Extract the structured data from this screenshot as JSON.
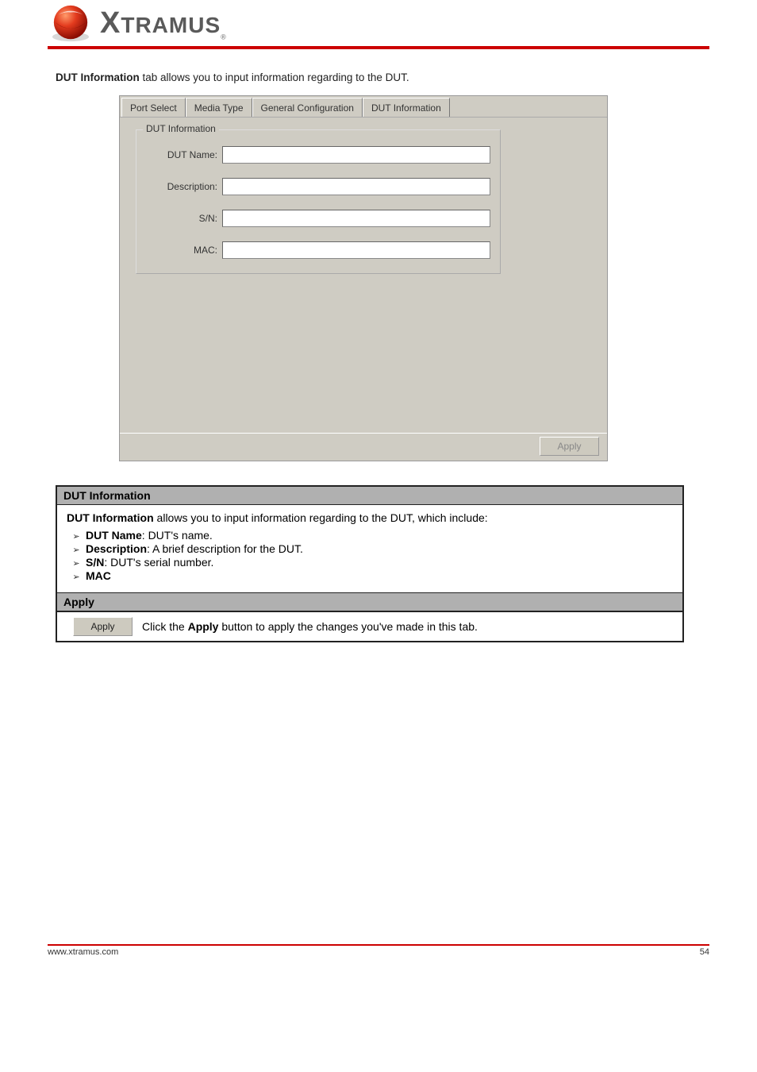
{
  "header": {
    "brand_first": "X",
    "brand_rest": "TRAMUS",
    "brand_reg": "®"
  },
  "intro": {
    "prefix": "DUT Information",
    "suffix": " tab allows you to input information regarding to the DUT."
  },
  "window": {
    "tabs": [
      "Port Select",
      "Media Type",
      "General Configuration",
      "DUT Information"
    ],
    "groupbox_title": "DUT Information",
    "fields": [
      {
        "label": "DUT Name:",
        "value": ""
      },
      {
        "label": "Description:",
        "value": ""
      },
      {
        "label": "S/N:",
        "value": ""
      },
      {
        "label": "MAC:",
        "value": ""
      }
    ],
    "apply_label": "Apply"
  },
  "desc": {
    "header": "DUT Information",
    "intro_prefix": "DUT Information",
    "intro_suffix": " allows you to input information regarding to the DUT, which include:",
    "bullets": [
      {
        "bold": "DUT Name",
        "rest": ": DUT's name."
      },
      {
        "bold": "Description",
        "rest": ": A brief description for the DUT."
      },
      {
        "bold": "S/N",
        "rest": ": DUT's serial number."
      },
      {
        "bold": "MAC",
        "rest": ""
      }
    ],
    "apply_header": "Apply",
    "apply_label": "Apply",
    "apply_prefix": "Click the ",
    "apply_bold": "Apply",
    "apply_suffix": " button to apply the changes you've made in this tab."
  },
  "footer": {
    "left": "www.xtramus.com",
    "right": "54"
  }
}
